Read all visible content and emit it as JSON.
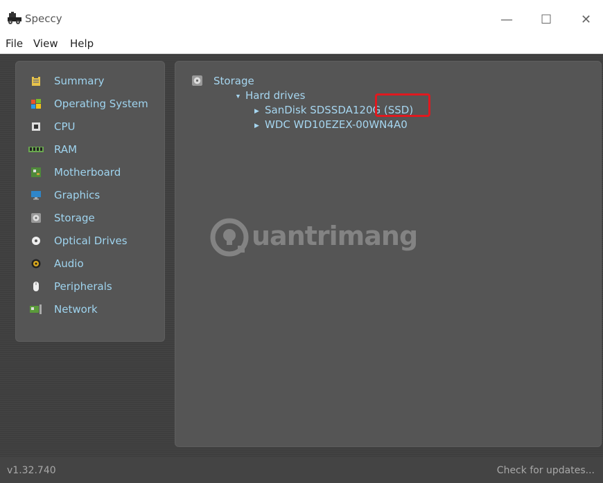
{
  "window": {
    "title": "Speccy",
    "minimize": "—",
    "maximize": "☐",
    "close": "✕"
  },
  "menu": {
    "items": [
      "File",
      "View",
      "Help"
    ]
  },
  "sidebar": {
    "items": [
      {
        "label": "Summary",
        "icon": "clipboard-icon"
      },
      {
        "label": "Operating System",
        "icon": "windows-logo-icon"
      },
      {
        "label": "CPU",
        "icon": "cpu-chip-icon"
      },
      {
        "label": "RAM",
        "icon": "ram-stick-icon"
      },
      {
        "label": "Motherboard",
        "icon": "motherboard-icon"
      },
      {
        "label": "Graphics",
        "icon": "monitor-icon"
      },
      {
        "label": "Storage",
        "icon": "hard-disk-icon"
      },
      {
        "label": "Optical Drives",
        "icon": "optical-disc-icon"
      },
      {
        "label": "Audio",
        "icon": "speaker-icon"
      },
      {
        "label": "Peripherals",
        "icon": "mouse-icon"
      },
      {
        "label": "Network",
        "icon": "network-card-icon"
      }
    ]
  },
  "content": {
    "root_label": "Storage",
    "group_label": "Hard drives",
    "drives": [
      {
        "label": "SanDisk SDSSDA120G (SSD)"
      },
      {
        "label": "WDC WD10EZEX-00WN4A0"
      }
    ]
  },
  "watermark": {
    "text": "uantrimang"
  },
  "status": {
    "version": "v1.32.740",
    "updates": "Check for updates..."
  },
  "colors": {
    "accent_text": "#9fd4ef",
    "highlight_border": "#e0191f",
    "panel_bg": "#555555"
  }
}
